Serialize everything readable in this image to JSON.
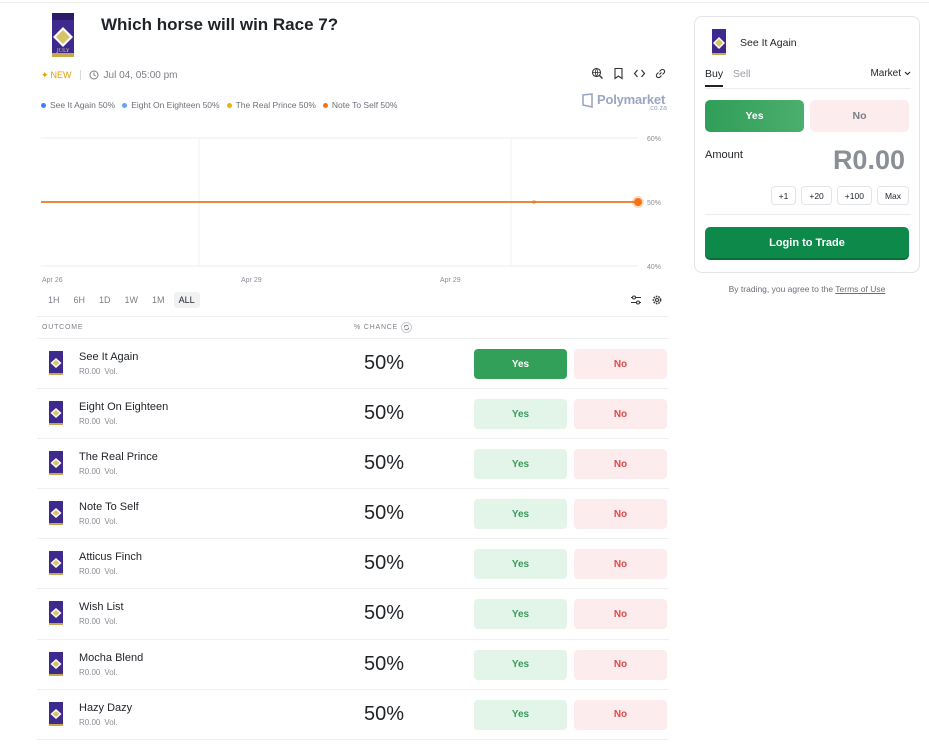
{
  "market": {
    "title": "Which horse will win Race 7?",
    "badge": "NEW",
    "datetime": "Jul 04, 05:00 pm",
    "logo_icon": "race-event-logo",
    "header_icons": [
      "globe-search-icon",
      "bookmark-icon",
      "embed-code-icon",
      "link-icon"
    ]
  },
  "legend": [
    {
      "label": "See It Again 50%",
      "color": "#3b82f6"
    },
    {
      "label": "Eight On Eighteen 50%",
      "color": "#60a5fa"
    },
    {
      "label": "The Real Prince 50%",
      "color": "#eab308"
    },
    {
      "label": "Note To Self 50%",
      "color": "#f97316"
    }
  ],
  "watermark": {
    "main": "Polymarket",
    "sub": ".co.za"
  },
  "chart_data": {
    "type": "line",
    "x_tick_labels": [
      "Apr 26",
      "Apr 29",
      "Apr 29"
    ],
    "y_tick_labels": [
      "60%",
      "50%",
      "40%"
    ],
    "ylim": [
      40,
      60
    ],
    "grid": true,
    "series": [
      {
        "name": "See It Again",
        "color": "#3b82f6",
        "values": [
          50,
          50
        ]
      },
      {
        "name": "Eight On Eighteen",
        "color": "#60a5fa",
        "values": [
          50,
          50
        ]
      },
      {
        "name": "The Real Prince",
        "color": "#eab308",
        "values": [
          50,
          50
        ]
      },
      {
        "name": "Note To Self",
        "color": "#f97316",
        "values": [
          50,
          50
        ]
      }
    ]
  },
  "ranges": [
    {
      "label": "1H",
      "active": false
    },
    {
      "label": "6H",
      "active": false
    },
    {
      "label": "1D",
      "active": false
    },
    {
      "label": "1W",
      "active": false
    },
    {
      "label": "1M",
      "active": false
    },
    {
      "label": "ALL",
      "active": true
    }
  ],
  "chart_tools": [
    "sliders-icon",
    "settings-icon"
  ],
  "table": {
    "col_outcome": "OUTCOME",
    "col_chance": "% CHANCE",
    "rows": [
      {
        "name": "See It Again",
        "volume": "R0.00",
        "vol_suffix": "Vol.",
        "chance": "50%",
        "yes": "Yes",
        "no": "No",
        "selected": true
      },
      {
        "name": "Eight On Eighteen",
        "volume": "R0.00",
        "vol_suffix": "Vol.",
        "chance": "50%",
        "yes": "Yes",
        "no": "No",
        "selected": false
      },
      {
        "name": "The Real Prince",
        "volume": "R0.00",
        "vol_suffix": "Vol.",
        "chance": "50%",
        "yes": "Yes",
        "no": "No",
        "selected": false
      },
      {
        "name": "Note To Self",
        "volume": "R0.00",
        "vol_suffix": "Vol.",
        "chance": "50%",
        "yes": "Yes",
        "no": "No",
        "selected": false
      },
      {
        "name": "Atticus Finch",
        "volume": "R0.00",
        "vol_suffix": "Vol.",
        "chance": "50%",
        "yes": "Yes",
        "no": "No",
        "selected": false
      },
      {
        "name": "Wish List",
        "volume": "R0.00",
        "vol_suffix": "Vol.",
        "chance": "50%",
        "yes": "Yes",
        "no": "No",
        "selected": false
      },
      {
        "name": "Mocha Blend",
        "volume": "R0.00",
        "vol_suffix": "Vol.",
        "chance": "50%",
        "yes": "Yes",
        "no": "No",
        "selected": false
      },
      {
        "name": "Hazy Dazy",
        "volume": "R0.00",
        "vol_suffix": "Vol.",
        "chance": "50%",
        "yes": "Yes",
        "no": "No",
        "selected": false
      }
    ]
  },
  "trade_panel": {
    "selected_outcome": "See It Again",
    "tab_buy": "Buy",
    "tab_sell": "Sell",
    "order_type": "Market",
    "yes_label": "Yes",
    "no_label": "No",
    "amount_label": "Amount",
    "amount_value": "R0.00",
    "quick_amounts": [
      "+1",
      "+20",
      "+100",
      "Max"
    ],
    "login_label": "Login to Trade"
  },
  "terms": {
    "prefix": "By trading, you agree to the",
    "link": "Terms of Use"
  },
  "colors": {
    "accent_green": "#0d8a4a",
    "yes_green": "#33a05a",
    "no_red": "#e04a4a",
    "new_badge": "#e0a100"
  }
}
